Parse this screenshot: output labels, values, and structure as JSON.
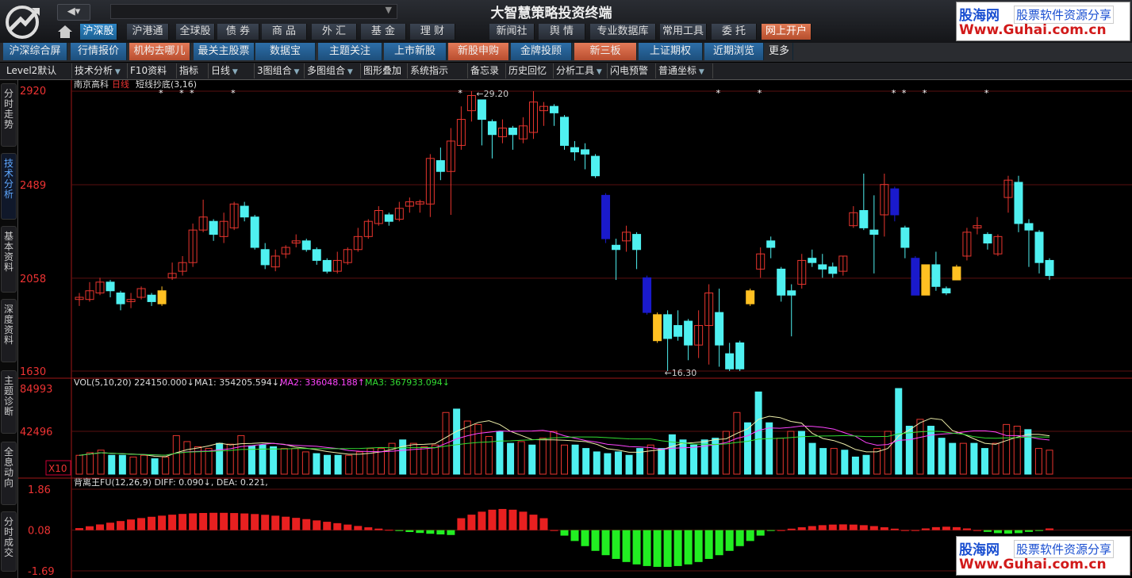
{
  "app": {
    "title": "大智慧策略投资终端",
    "nav": {
      "back_icon": "back-arrow-icon",
      "forward_icon": "dropdown-icon"
    }
  },
  "main_tabs": [
    {
      "label": "沪深股",
      "selected": true
    },
    {
      "label": "沪港通"
    },
    {
      "label": "全球股"
    },
    {
      "label": "债 券"
    },
    {
      "label": "商 品"
    },
    {
      "label": "外 汇"
    },
    {
      "label": "基 金"
    },
    {
      "label": "理 财"
    }
  ],
  "right_tabs": [
    {
      "label": "新闻社"
    },
    {
      "label": "舆 情"
    },
    {
      "label": "专业数据库"
    },
    {
      "label": "常用工具"
    },
    {
      "label": "委 托"
    },
    {
      "label": "网上开户",
      "accent": true
    }
  ],
  "row2_tabs": [
    {
      "label": "沪深综合屏"
    },
    {
      "label": "行情报价"
    },
    {
      "label": "机构去哪儿",
      "accent": true
    },
    {
      "label": "最关主股票池"
    },
    {
      "label": "数据宝"
    },
    {
      "label": "主题关注"
    },
    {
      "label": "上市新股"
    },
    {
      "label": "新股申购",
      "accent": true
    },
    {
      "label": "金牌投顾"
    },
    {
      "label": "新三板",
      "accent": true
    },
    {
      "label": "上证期权"
    },
    {
      "label": "近期浏览"
    },
    {
      "label": "更多"
    }
  ],
  "toolbar": [
    {
      "label": "Level2默认"
    },
    {
      "label": "技术分析"
    },
    {
      "label": "F10资料"
    },
    {
      "label": "指标"
    },
    {
      "label": "日线"
    },
    {
      "label": "3图组合"
    },
    {
      "label": "多图组合"
    },
    {
      "label": "图形叠加"
    },
    {
      "label": "系统指示"
    },
    {
      "label": "备忘录"
    },
    {
      "label": "历史回忆"
    },
    {
      "label": "分析工具"
    },
    {
      "label": "闪电预警"
    },
    {
      "label": "普通坐标"
    }
  ],
  "sidebar": [
    {
      "label": "分时走势"
    },
    {
      "label": "技术分析",
      "selected": true
    },
    {
      "label": "基本资料"
    },
    {
      "label": "深度资料"
    },
    {
      "label": "主题诊断"
    },
    {
      "label": "全息动向"
    },
    {
      "label": "分时成交"
    }
  ],
  "ads": [
    {
      "line1": "股海网",
      "line1b": "股票软件资源分享",
      "line2": "Www.Guhai.com.cn"
    },
    {
      "line1": "股海网",
      "line1b": "股票软件资源分享",
      "line2": "Www.Guhai.com.cn"
    }
  ],
  "chart_data": [
    {
      "type": "candlestick",
      "stock": "南京高科",
      "period": "日线",
      "indicator": "短线抄底(3,16)",
      "yticks": [
        "2920",
        "2489",
        "2058",
        "1630"
      ],
      "ylim": [
        16.3,
        29.2
      ],
      "high_marker": "29.20",
      "low_marker": "16.30",
      "candles": [
        {
          "o": 19.6,
          "c": 19.7,
          "h": 19.9,
          "l": 19.3
        },
        {
          "o": 19.6,
          "c": 20.0,
          "h": 20.4,
          "l": 19.5
        },
        {
          "o": 19.9,
          "c": 20.4,
          "h": 20.6,
          "l": 19.8
        },
        {
          "o": 20.4,
          "c": 20.0,
          "h": 20.5,
          "l": 19.7
        },
        {
          "o": 19.9,
          "c": 19.4,
          "h": 20.0,
          "l": 19.1
        },
        {
          "o": 19.5,
          "c": 19.6,
          "h": 19.9,
          "l": 19.2
        },
        {
          "o": 19.7,
          "c": 20.1,
          "h": 20.2,
          "l": 19.6
        },
        {
          "o": 19.8,
          "c": 19.5,
          "h": 19.9,
          "l": 19.3
        },
        {
          "o": 19.4,
          "c": 20.0,
          "h": 20.2,
          "l": 19.3
        },
        {
          "o": 20.6,
          "c": 20.8,
          "h": 21.3,
          "l": 20.5
        },
        {
          "o": 20.9,
          "c": 21.3,
          "h": 21.6,
          "l": 20.7
        },
        {
          "o": 21.3,
          "c": 22.8,
          "h": 23.1,
          "l": 21.1
        },
        {
          "o": 22.8,
          "c": 23.4,
          "h": 24.2,
          "l": 22.7
        },
        {
          "o": 23.2,
          "c": 22.6,
          "h": 23.3,
          "l": 22.3
        },
        {
          "o": 22.5,
          "c": 23.2,
          "h": 23.6,
          "l": 22.2
        },
        {
          "o": 22.9,
          "c": 24.0,
          "h": 24.1,
          "l": 22.8
        },
        {
          "o": 23.9,
          "c": 23.4,
          "h": 24.1,
          "l": 23.2
        },
        {
          "o": 23.4,
          "c": 22.0,
          "h": 23.5,
          "l": 21.9
        },
        {
          "o": 21.9,
          "c": 21.2,
          "h": 22.2,
          "l": 21.0
        },
        {
          "o": 21.1,
          "c": 21.6,
          "h": 21.9,
          "l": 20.9
        },
        {
          "o": 21.7,
          "c": 22.0,
          "h": 22.1,
          "l": 21.5
        },
        {
          "o": 22.2,
          "c": 22.3,
          "h": 22.6,
          "l": 22.0
        },
        {
          "o": 22.3,
          "c": 21.9,
          "h": 22.4,
          "l": 21.8
        },
        {
          "o": 21.9,
          "c": 21.4,
          "h": 22.0,
          "l": 21.2
        },
        {
          "o": 21.4,
          "c": 20.9,
          "h": 21.5,
          "l": 20.8
        },
        {
          "o": 20.9,
          "c": 21.4,
          "h": 21.8,
          "l": 20.8
        },
        {
          "o": 21.3,
          "c": 21.9,
          "h": 22.0,
          "l": 21.2
        },
        {
          "o": 21.9,
          "c": 22.5,
          "h": 22.9,
          "l": 21.8
        },
        {
          "o": 22.5,
          "c": 23.2,
          "h": 23.3,
          "l": 22.4
        },
        {
          "o": 23.1,
          "c": 23.7,
          "h": 23.9,
          "l": 23.0
        },
        {
          "o": 23.5,
          "c": 23.2,
          "h": 23.6,
          "l": 23.0
        },
        {
          "o": 23.3,
          "c": 23.8,
          "h": 24.1,
          "l": 23.2
        },
        {
          "o": 23.9,
          "c": 24.1,
          "h": 24.3,
          "l": 23.6
        },
        {
          "o": 24.0,
          "c": 24.1,
          "h": 24.2,
          "l": 23.6
        },
        {
          "o": 24.0,
          "c": 26.1,
          "h": 26.3,
          "l": 23.4
        },
        {
          "o": 26.0,
          "c": 25.5,
          "h": 26.6,
          "l": 25.1
        },
        {
          "o": 25.5,
          "c": 26.9,
          "h": 27.5,
          "l": 23.5
        },
        {
          "o": 26.7,
          "c": 27.9,
          "h": 28.5,
          "l": 26.5
        },
        {
          "o": 28.3,
          "c": 29.0,
          "h": 29.2,
          "l": 27.8
        },
        {
          "o": 28.8,
          "c": 27.9,
          "h": 28.8,
          "l": 26.7
        },
        {
          "o": 27.8,
          "c": 27.2,
          "h": 27.9,
          "l": 26.1
        },
        {
          "o": 27.1,
          "c": 27.5,
          "h": 27.9,
          "l": 26.8
        },
        {
          "o": 27.5,
          "c": 27.2,
          "h": 27.6,
          "l": 26.5
        },
        {
          "o": 27.0,
          "c": 27.6,
          "h": 28.0,
          "l": 26.8
        },
        {
          "o": 27.3,
          "c": 28.7,
          "h": 29.2,
          "l": 27.0
        },
        {
          "o": 28.3,
          "c": 28.5,
          "h": 28.7,
          "l": 27.6
        },
        {
          "o": 28.5,
          "c": 28.2,
          "h": 28.6,
          "l": 27.6
        },
        {
          "o": 28.0,
          "c": 26.7,
          "h": 28.1,
          "l": 26.5
        },
        {
          "o": 26.6,
          "c": 26.4,
          "h": 26.9,
          "l": 26.0
        },
        {
          "o": 26.5,
          "c": 26.3,
          "h": 26.8,
          "l": 25.6
        },
        {
          "o": 26.2,
          "c": 25.3,
          "h": 26.3,
          "l": 25.2
        },
        {
          "o": 24.4,
          "c": 22.4,
          "h": 24.5,
          "l": 22.2
        },
        {
          "o": 22.1,
          "c": 21.9,
          "h": 22.4,
          "l": 20.5
        },
        {
          "o": 22.3,
          "c": 22.7,
          "h": 23.0,
          "l": 21.8
        },
        {
          "o": 22.6,
          "c": 21.9,
          "h": 22.7,
          "l": 21.0
        },
        {
          "o": 20.6,
          "c": 19.0,
          "h": 20.7,
          "l": 18.9
        },
        {
          "o": 18.9,
          "c": 17.7,
          "h": 19.0,
          "l": 17.6
        },
        {
          "o": 18.9,
          "c": 17.8,
          "h": 19.1,
          "l": 16.3
        },
        {
          "o": 18.4,
          "c": 17.9,
          "h": 19.1,
          "l": 17.7
        },
        {
          "o": 18.6,
          "c": 17.5,
          "h": 18.7,
          "l": 16.8
        },
        {
          "o": 17.5,
          "c": 18.4,
          "h": 19.1,
          "l": 16.9
        },
        {
          "o": 18.4,
          "c": 19.9,
          "h": 20.3,
          "l": 16.6
        },
        {
          "o": 19.0,
          "c": 17.5,
          "h": 20.1,
          "l": 16.5
        },
        {
          "o": 17.1,
          "c": 16.4,
          "h": 17.6,
          "l": 16.3
        },
        {
          "o": 17.6,
          "c": 16.4,
          "h": 17.7,
          "l": 16.3
        },
        {
          "o": 19.4,
          "c": 20.0,
          "h": 20.1,
          "l": 19.3
        },
        {
          "o": 21.0,
          "c": 21.7,
          "h": 22.0,
          "l": 20.6
        },
        {
          "o": 22.3,
          "c": 22.0,
          "h": 22.5,
          "l": 21.5
        },
        {
          "o": 21.0,
          "c": 19.8,
          "h": 21.1,
          "l": 19.5
        },
        {
          "o": 20.0,
          "c": 19.8,
          "h": 20.3,
          "l": 17.9
        },
        {
          "o": 20.3,
          "c": 21.4,
          "h": 21.7,
          "l": 20.1
        },
        {
          "o": 21.5,
          "c": 21.3,
          "h": 21.9,
          "l": 21.1
        },
        {
          "o": 21.2,
          "c": 21.0,
          "h": 21.7,
          "l": 20.6
        },
        {
          "o": 21.1,
          "c": 20.8,
          "h": 21.3,
          "l": 20.6
        },
        {
          "o": 20.9,
          "c": 21.6,
          "h": 21.6,
          "l": 20.7
        },
        {
          "o": 23.0,
          "c": 23.6,
          "h": 23.9,
          "l": 22.9
        },
        {
          "o": 23.7,
          "c": 22.9,
          "h": 25.4,
          "l": 22.8
        },
        {
          "o": 22.8,
          "c": 22.6,
          "h": 24.4,
          "l": 20.8
        },
        {
          "o": 23.5,
          "c": 24.9,
          "h": 25.4,
          "l": 22.5
        },
        {
          "o": 24.7,
          "c": 23.5,
          "h": 24.8,
          "l": 23.2
        },
        {
          "o": 22.9,
          "c": 22.0,
          "h": 23.0,
          "l": 21.5
        },
        {
          "o": 21.5,
          "c": 19.8,
          "h": 21.6,
          "l": 19.8
        },
        {
          "o": 19.8,
          "c": 21.2,
          "h": 21.2,
          "l": 19.8
        },
        {
          "o": 21.2,
          "c": 20.2,
          "h": 21.8,
          "l": 20.0
        },
        {
          "o": 20.1,
          "c": 19.9,
          "h": 20.2,
          "l": 19.8
        },
        {
          "o": 20.5,
          "c": 21.1,
          "h": 21.2,
          "l": 20.5
        },
        {
          "o": 21.6,
          "c": 22.7,
          "h": 22.9,
          "l": 21.4
        },
        {
          "o": 22.9,
          "c": 23.0,
          "h": 23.4,
          "l": 22.6
        },
        {
          "o": 22.6,
          "c": 22.2,
          "h": 22.7,
          "l": 21.9
        },
        {
          "o": 21.7,
          "c": 22.5,
          "h": 22.6,
          "l": 21.6
        },
        {
          "o": 24.3,
          "c": 25.1,
          "h": 25.3,
          "l": 23.6
        },
        {
          "o": 25.0,
          "c": 23.1,
          "h": 25.3,
          "l": 22.7
        },
        {
          "o": 23.1,
          "c": 22.8,
          "h": 23.3,
          "l": 21.1
        },
        {
          "o": 22.7,
          "c": 21.3,
          "h": 22.8,
          "l": 20.8
        },
        {
          "o": 21.4,
          "c": 20.7,
          "h": 21.5,
          "l": 20.5
        }
      ]
    },
    {
      "type": "bar",
      "label": "VOL(5,10,20)",
      "value": "224150.000",
      "ma1_label": "MA1:",
      "ma1": "354205.594",
      "ma2_label": "MA2:",
      "ma2": "336048.188",
      "ma3_label": "MA3:",
      "ma3": "367933.094",
      "yticks": [
        "84993",
        "42496",
        "X10"
      ],
      "ylim": [
        0,
        84993
      ]
    },
    {
      "type": "bar",
      "label": "背离王FU(12,26,9)",
      "diff_label": "DIFF:",
      "diff": "0.090",
      "dea_label": "DEA:",
      "dea": "0.221",
      "yticks": [
        "1.86",
        "0.08",
        "-1.69"
      ],
      "ylim": [
        -1.69,
        1.86
      ]
    }
  ]
}
